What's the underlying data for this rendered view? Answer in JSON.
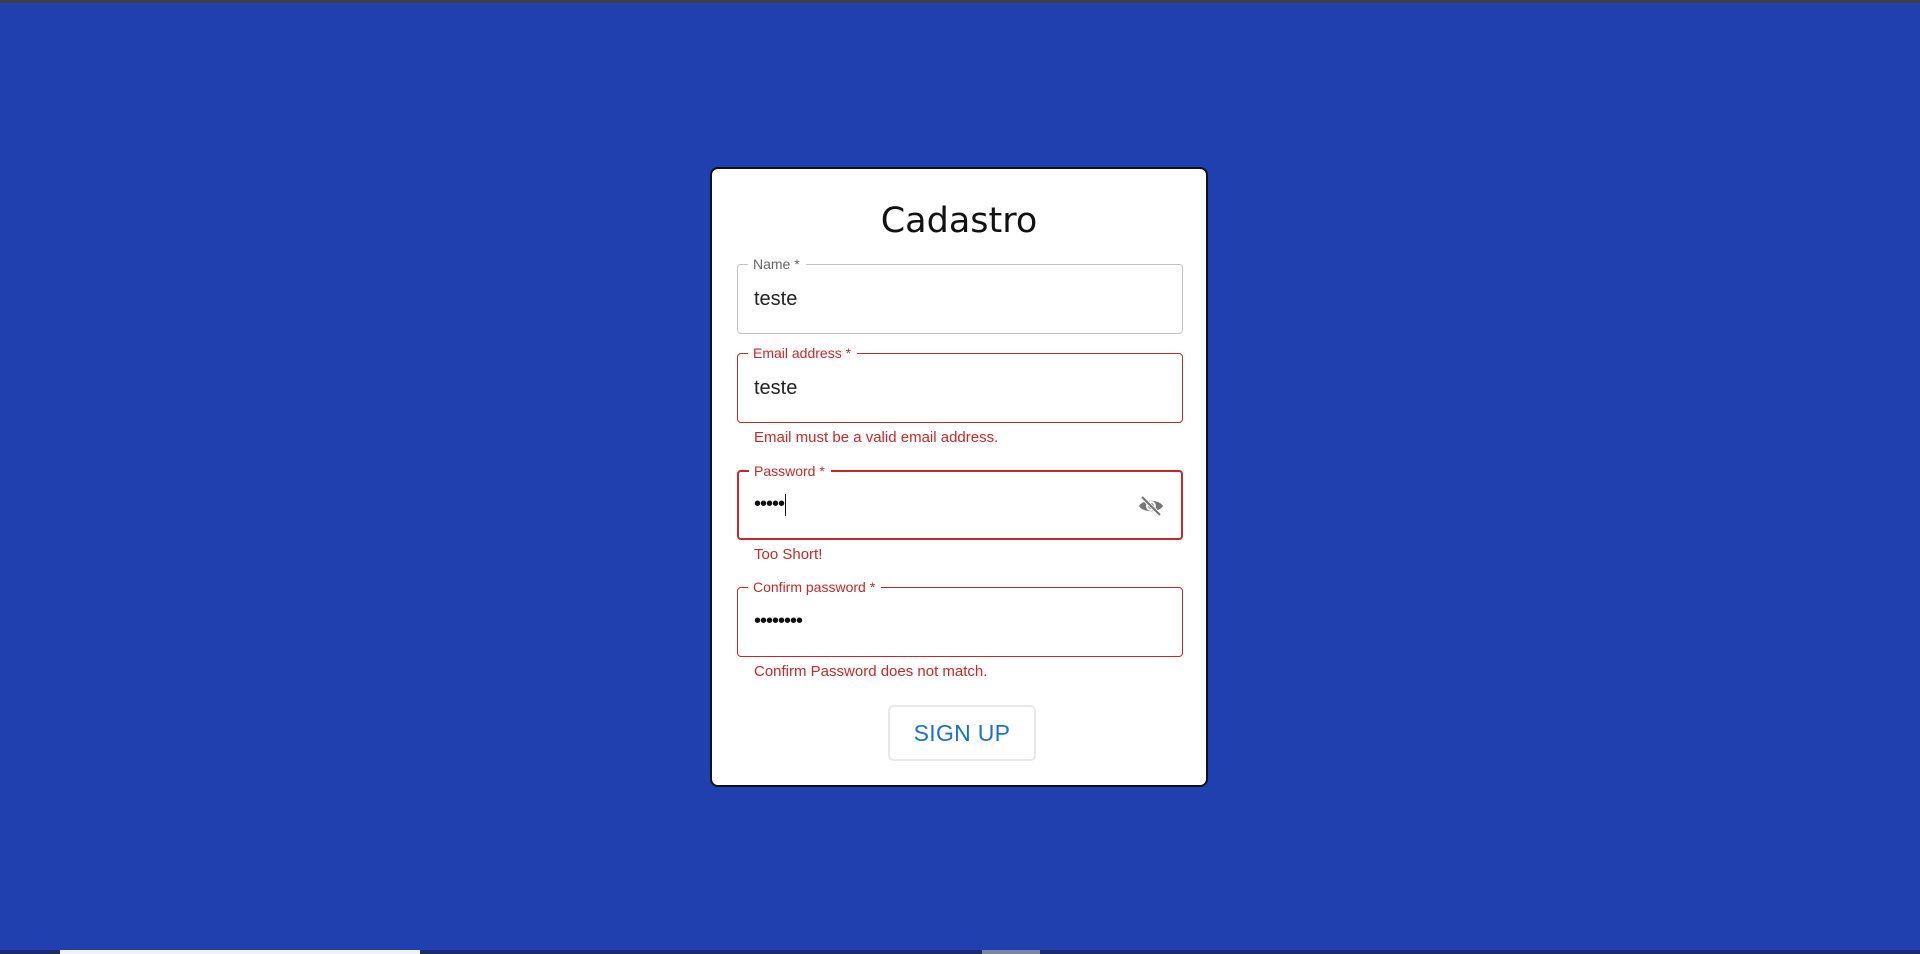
{
  "form": {
    "title": "Cadastro",
    "name": {
      "label": "Name *",
      "value": "teste"
    },
    "email": {
      "label": "Email address *",
      "value": "teste",
      "error": "Email must be a valid email address."
    },
    "password": {
      "label": "Password *",
      "masked": "•••••",
      "error": "Too Short!",
      "toggle_icon": "eye-off-icon"
    },
    "confirm_password": {
      "label": "Confirm password *",
      "masked": "••••••••",
      "error": "Confirm Password does not match."
    },
    "signup_label": "SIGN UP"
  },
  "colors": {
    "background": "#1f40ae",
    "card": "#ffffff",
    "error": "#c62828",
    "button_text": "#1c6fd1"
  }
}
